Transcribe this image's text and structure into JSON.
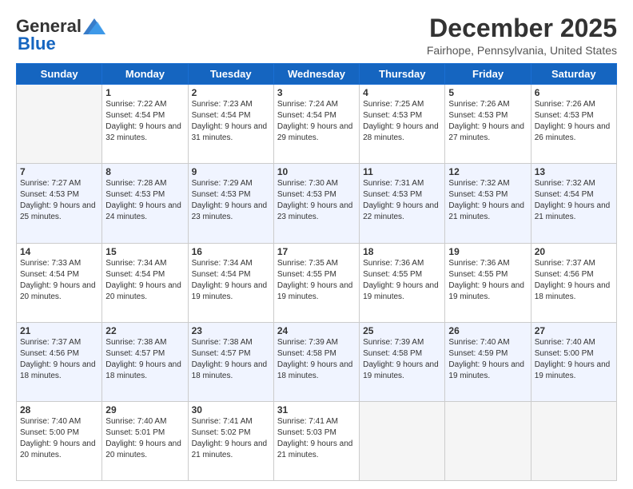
{
  "header": {
    "logo_general": "General",
    "logo_blue": "Blue",
    "month_title": "December 2025",
    "location": "Fairhope, Pennsylvania, United States"
  },
  "weekdays": [
    "Sunday",
    "Monday",
    "Tuesday",
    "Wednesday",
    "Thursday",
    "Friday",
    "Saturday"
  ],
  "weeks": [
    [
      {
        "day": "",
        "empty": true
      },
      {
        "day": "1",
        "sunrise": "Sunrise: 7:22 AM",
        "sunset": "Sunset: 4:54 PM",
        "daylight": "Daylight: 9 hours and 32 minutes."
      },
      {
        "day": "2",
        "sunrise": "Sunrise: 7:23 AM",
        "sunset": "Sunset: 4:54 PM",
        "daylight": "Daylight: 9 hours and 31 minutes."
      },
      {
        "day": "3",
        "sunrise": "Sunrise: 7:24 AM",
        "sunset": "Sunset: 4:54 PM",
        "daylight": "Daylight: 9 hours and 29 minutes."
      },
      {
        "day": "4",
        "sunrise": "Sunrise: 7:25 AM",
        "sunset": "Sunset: 4:53 PM",
        "daylight": "Daylight: 9 hours and 28 minutes."
      },
      {
        "day": "5",
        "sunrise": "Sunrise: 7:26 AM",
        "sunset": "Sunset: 4:53 PM",
        "daylight": "Daylight: 9 hours and 27 minutes."
      },
      {
        "day": "6",
        "sunrise": "Sunrise: 7:26 AM",
        "sunset": "Sunset: 4:53 PM",
        "daylight": "Daylight: 9 hours and 26 minutes."
      }
    ],
    [
      {
        "day": "7",
        "sunrise": "Sunrise: 7:27 AM",
        "sunset": "Sunset: 4:53 PM",
        "daylight": "Daylight: 9 hours and 25 minutes."
      },
      {
        "day": "8",
        "sunrise": "Sunrise: 7:28 AM",
        "sunset": "Sunset: 4:53 PM",
        "daylight": "Daylight: 9 hours and 24 minutes."
      },
      {
        "day": "9",
        "sunrise": "Sunrise: 7:29 AM",
        "sunset": "Sunset: 4:53 PM",
        "daylight": "Daylight: 9 hours and 23 minutes."
      },
      {
        "day": "10",
        "sunrise": "Sunrise: 7:30 AM",
        "sunset": "Sunset: 4:53 PM",
        "daylight": "Daylight: 9 hours and 23 minutes."
      },
      {
        "day": "11",
        "sunrise": "Sunrise: 7:31 AM",
        "sunset": "Sunset: 4:53 PM",
        "daylight": "Daylight: 9 hours and 22 minutes."
      },
      {
        "day": "12",
        "sunrise": "Sunrise: 7:32 AM",
        "sunset": "Sunset: 4:53 PM",
        "daylight": "Daylight: 9 hours and 21 minutes."
      },
      {
        "day": "13",
        "sunrise": "Sunrise: 7:32 AM",
        "sunset": "Sunset: 4:54 PM",
        "daylight": "Daylight: 9 hours and 21 minutes."
      }
    ],
    [
      {
        "day": "14",
        "sunrise": "Sunrise: 7:33 AM",
        "sunset": "Sunset: 4:54 PM",
        "daylight": "Daylight: 9 hours and 20 minutes."
      },
      {
        "day": "15",
        "sunrise": "Sunrise: 7:34 AM",
        "sunset": "Sunset: 4:54 PM",
        "daylight": "Daylight: 9 hours and 20 minutes."
      },
      {
        "day": "16",
        "sunrise": "Sunrise: 7:34 AM",
        "sunset": "Sunset: 4:54 PM",
        "daylight": "Daylight: 9 hours and 19 minutes."
      },
      {
        "day": "17",
        "sunrise": "Sunrise: 7:35 AM",
        "sunset": "Sunset: 4:55 PM",
        "daylight": "Daylight: 9 hours and 19 minutes."
      },
      {
        "day": "18",
        "sunrise": "Sunrise: 7:36 AM",
        "sunset": "Sunset: 4:55 PM",
        "daylight": "Daylight: 9 hours and 19 minutes."
      },
      {
        "day": "19",
        "sunrise": "Sunrise: 7:36 AM",
        "sunset": "Sunset: 4:55 PM",
        "daylight": "Daylight: 9 hours and 19 minutes."
      },
      {
        "day": "20",
        "sunrise": "Sunrise: 7:37 AM",
        "sunset": "Sunset: 4:56 PM",
        "daylight": "Daylight: 9 hours and 18 minutes."
      }
    ],
    [
      {
        "day": "21",
        "sunrise": "Sunrise: 7:37 AM",
        "sunset": "Sunset: 4:56 PM",
        "daylight": "Daylight: 9 hours and 18 minutes."
      },
      {
        "day": "22",
        "sunrise": "Sunrise: 7:38 AM",
        "sunset": "Sunset: 4:57 PM",
        "daylight": "Daylight: 9 hours and 18 minutes."
      },
      {
        "day": "23",
        "sunrise": "Sunrise: 7:38 AM",
        "sunset": "Sunset: 4:57 PM",
        "daylight": "Daylight: 9 hours and 18 minutes."
      },
      {
        "day": "24",
        "sunrise": "Sunrise: 7:39 AM",
        "sunset": "Sunset: 4:58 PM",
        "daylight": "Daylight: 9 hours and 18 minutes."
      },
      {
        "day": "25",
        "sunrise": "Sunrise: 7:39 AM",
        "sunset": "Sunset: 4:58 PM",
        "daylight": "Daylight: 9 hours and 19 minutes."
      },
      {
        "day": "26",
        "sunrise": "Sunrise: 7:40 AM",
        "sunset": "Sunset: 4:59 PM",
        "daylight": "Daylight: 9 hours and 19 minutes."
      },
      {
        "day": "27",
        "sunrise": "Sunrise: 7:40 AM",
        "sunset": "Sunset: 5:00 PM",
        "daylight": "Daylight: 9 hours and 19 minutes."
      }
    ],
    [
      {
        "day": "28",
        "sunrise": "Sunrise: 7:40 AM",
        "sunset": "Sunset: 5:00 PM",
        "daylight": "Daylight: 9 hours and 20 minutes."
      },
      {
        "day": "29",
        "sunrise": "Sunrise: 7:40 AM",
        "sunset": "Sunset: 5:01 PM",
        "daylight": "Daylight: 9 hours and 20 minutes."
      },
      {
        "day": "30",
        "sunrise": "Sunrise: 7:41 AM",
        "sunset": "Sunset: 5:02 PM",
        "daylight": "Daylight: 9 hours and 21 minutes."
      },
      {
        "day": "31",
        "sunrise": "Sunrise: 7:41 AM",
        "sunset": "Sunset: 5:03 PM",
        "daylight": "Daylight: 9 hours and 21 minutes."
      },
      {
        "day": "",
        "empty": true
      },
      {
        "day": "",
        "empty": true
      },
      {
        "day": "",
        "empty": true
      }
    ]
  ]
}
